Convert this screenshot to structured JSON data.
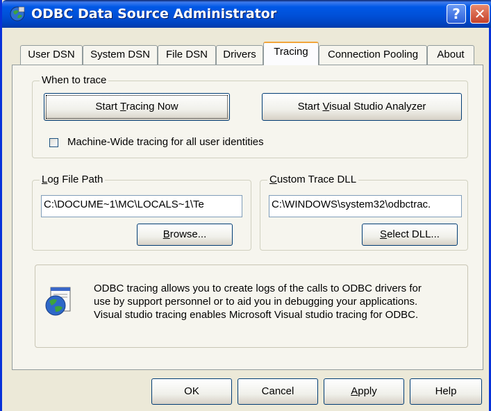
{
  "window": {
    "title": "ODBC Data Source Administrator"
  },
  "tabs": [
    {
      "label": "User DSN"
    },
    {
      "label": "System DSN"
    },
    {
      "label": "File DSN"
    },
    {
      "label": "Drivers"
    },
    {
      "label": "Tracing"
    },
    {
      "label": "Connection Pooling"
    },
    {
      "label": "About"
    }
  ],
  "active_tab": "Tracing",
  "when_to_trace": {
    "legend": "When to trace",
    "start_tracing": {
      "pre": "Start ",
      "key": "T",
      "post": "racing Now"
    },
    "start_vs_analyzer": {
      "pre": "Start ",
      "key": "V",
      "post": "isual Studio Analyzer"
    },
    "machine_wide_label": "Machine-Wide tracing for all user identities",
    "machine_wide_checked": false
  },
  "log_file": {
    "legend_key": "L",
    "legend_rest": "og File Path",
    "value": "C:\\DOCUME~1\\MC\\LOCALS~1\\Te",
    "browse": {
      "key": "B",
      "rest": "rowse..."
    }
  },
  "custom_dll": {
    "legend_key": "C",
    "legend_rest": "ustom Trace DLL",
    "value": "C:\\WINDOWS\\system32\\odbctrac.",
    "select": {
      "key": "S",
      "rest": "elect DLL..."
    }
  },
  "info": {
    "lines": [
      "ODBC tracing allows you to create logs of the calls to ODBC drivers for",
      "use by support personnel or to aid you in debugging your applications.",
      "Visual studio tracing enables Microsoft Visual studio tracing for ODBC."
    ]
  },
  "footer": {
    "ok": "OK",
    "cancel": "Cancel",
    "apply": {
      "key": "A",
      "rest": "pply"
    },
    "help": "Help"
  },
  "icons": [
    "app-icon",
    "help-icon",
    "close-icon",
    "odbc-globe-icon"
  ],
  "colors": {
    "face": "#ECE9D8",
    "titlebar": "#0050D8",
    "tab_highlight": "#F1A53B",
    "border": "#003C74"
  }
}
